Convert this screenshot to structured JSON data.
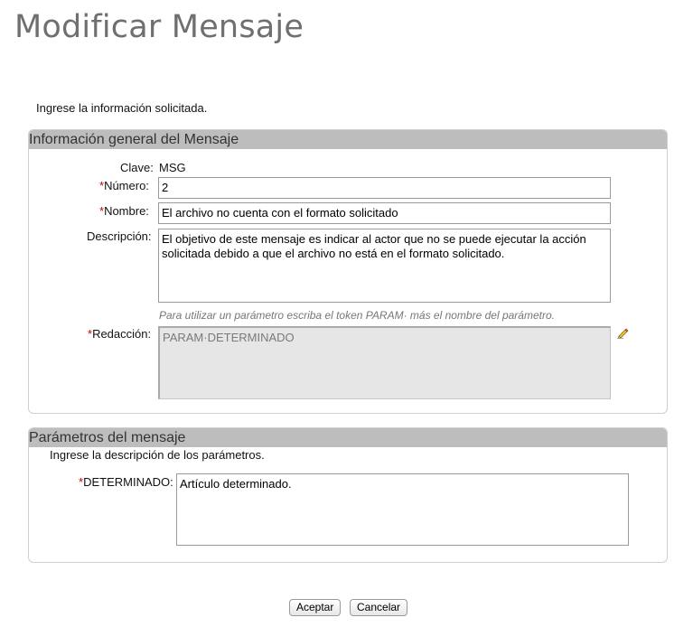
{
  "page": {
    "title": "Modificar Mensaje",
    "instructions": "Ingrese la información solicitada."
  },
  "general_section": {
    "header": "Información general del Mensaje",
    "clave_label": "Clave:",
    "clave_value": "MSG",
    "numero_label": "Número:",
    "numero_value": "2",
    "nombre_label": "Nombre:",
    "nombre_value": "El archivo no cuenta con el formato solicitado",
    "descripcion_label": "Descripción:",
    "descripcion_value": "El objetivo de este mensaje es indicar al actor que no se puede ejecutar la acción solicitada debido a que el archivo no está en el formato solicitado.",
    "param_hint": "Para utilizar un parámetro escriba el token PARAM· más el nombre del parámetro.",
    "redaccion_label": "Redacción:",
    "redaccion_value": "PARAM·DETERMINADO",
    "required_marker": "*",
    "edit_icon": "pencil-icon"
  },
  "params_section": {
    "header": "Parámetros del mensaje",
    "instructions": "Ingrese la descripción de los parámetros.",
    "determinado_label": "DETERMINADO:",
    "determinado_value": "Artículo determinado."
  },
  "buttons": {
    "accept_label": "Aceptar",
    "cancel_label": "Cancelar"
  },
  "colors": {
    "required": "#cc0000",
    "section_header_bg": "#bdbdbd",
    "title": "#6f6f6f"
  }
}
